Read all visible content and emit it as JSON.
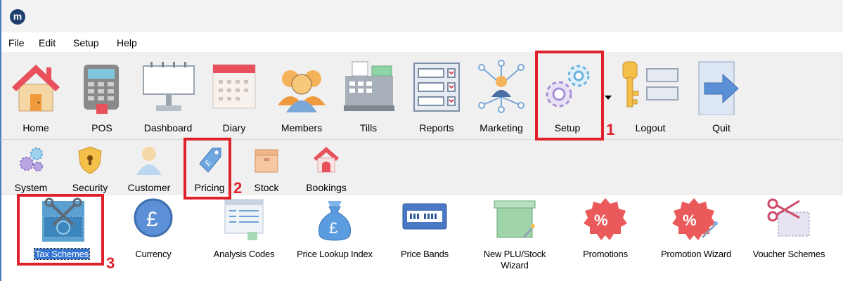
{
  "app": {
    "logo_letter": "m"
  },
  "menu": [
    "File",
    "Edit",
    "Setup",
    "Help"
  ],
  "toolbar": {
    "items": [
      {
        "label": "Home",
        "icon": "home-icon"
      },
      {
        "label": "POS",
        "icon": "pos-terminal-icon"
      },
      {
        "label": "Dashboard",
        "icon": "dashboard-board-icon"
      },
      {
        "label": "Diary",
        "icon": "calendar-icon"
      },
      {
        "label": "Members",
        "icon": "members-group-icon"
      },
      {
        "label": "Tills",
        "icon": "cash-register-icon"
      },
      {
        "label": "Reports",
        "icon": "report-form-icon"
      },
      {
        "label": "Marketing",
        "icon": "network-person-icon"
      },
      {
        "label": "Setup",
        "icon": "gears-icon"
      },
      {
        "label": "Logout",
        "icon": "key-icon"
      },
      {
        "label": "Quit",
        "icon": "exit-arrow-icon"
      }
    ]
  },
  "setup_ribbon": {
    "items": [
      {
        "label": "System",
        "icon": "system-gears-icon"
      },
      {
        "label": "Security",
        "icon": "security-shield-icon"
      },
      {
        "label": "Customer",
        "icon": "customer-person-icon"
      },
      {
        "label": "Pricing",
        "icon": "price-tag-icon"
      },
      {
        "label": "Stock",
        "icon": "stock-box-icon"
      },
      {
        "label": "Bookings",
        "icon": "bookings-house-icon"
      }
    ]
  },
  "pricing_panel": {
    "items": [
      {
        "label": "Tax Schemes",
        "icon": "tax-scissors-icon",
        "selected": true
      },
      {
        "label": "Currency",
        "icon": "pound-coin-icon"
      },
      {
        "label": "Analysis Codes",
        "icon": "document-list-icon"
      },
      {
        "label": "Price Lookup Index",
        "icon": "money-bag-icon"
      },
      {
        "label": "Price Bands",
        "icon": "price-band-icon"
      },
      {
        "label": "New PLU/Stock Wizard",
        "icon": "box-wand-icon"
      },
      {
        "label": "Promotions",
        "icon": "percent-badge-icon"
      },
      {
        "label": "Promotion Wizard",
        "icon": "percent-wand-icon"
      },
      {
        "label": "Voucher Schemes",
        "icon": "voucher-scissors-icon"
      }
    ]
  },
  "annotations": {
    "step1": "1",
    "step2": "2",
    "step3": "3",
    "color": "#e0202a"
  }
}
